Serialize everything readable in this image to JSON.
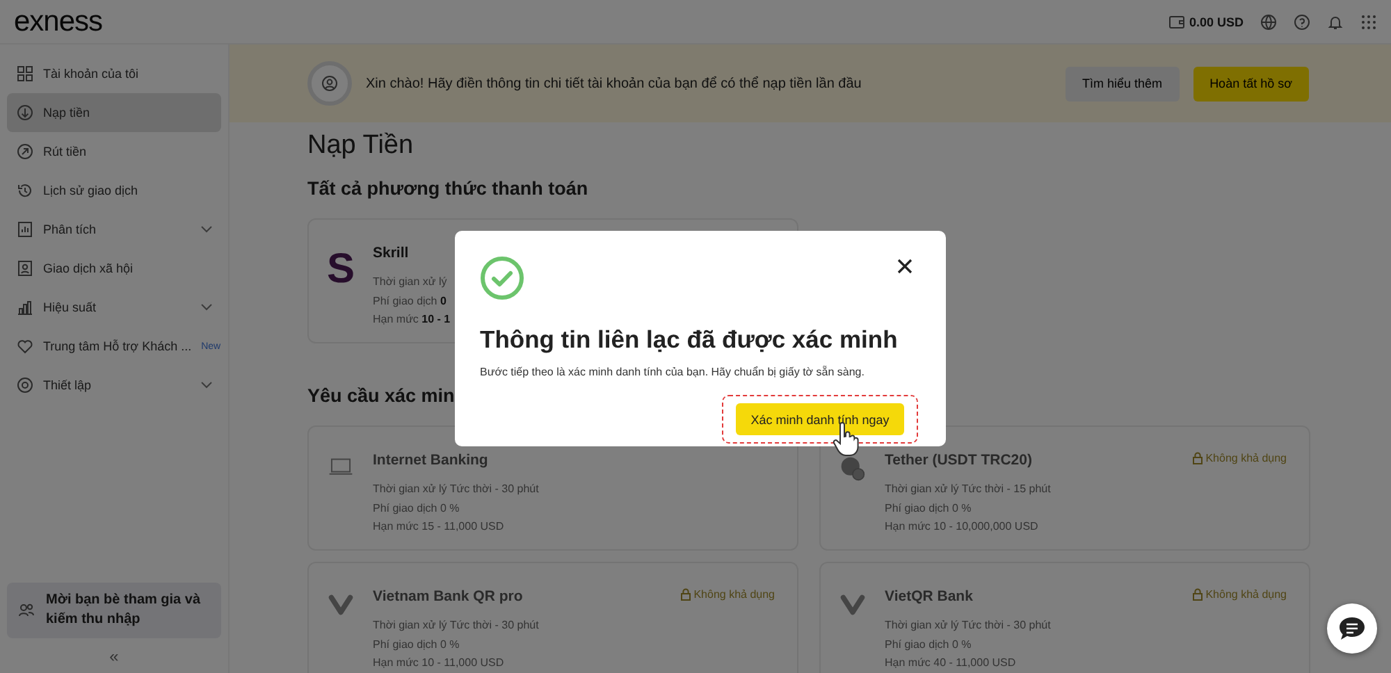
{
  "header": {
    "logo": "exness",
    "balance": "0.00 USD"
  },
  "sidebar": {
    "items": [
      {
        "label": "Tài khoản của tôi",
        "selected": false,
        "expandable": false
      },
      {
        "label": "Nạp tiền",
        "selected": true,
        "expandable": false
      },
      {
        "label": "Rút tiền",
        "selected": false,
        "expandable": false
      },
      {
        "label": "Lịch sử giao dịch",
        "selected": false,
        "expandable": false
      },
      {
        "label": "Phân tích",
        "selected": false,
        "expandable": true
      },
      {
        "label": "Giao dịch xã hội",
        "selected": false,
        "expandable": false
      },
      {
        "label": "Hiệu suất",
        "selected": false,
        "expandable": true
      },
      {
        "label": "Trung tâm Hỗ trợ Khách ...",
        "selected": false,
        "expandable": false,
        "badge": "New"
      },
      {
        "label": "Thiết lập",
        "selected": false,
        "expandable": true
      }
    ],
    "invite": "Mời bạn bè tham gia và kiếm thu nhập",
    "collapse": "«"
  },
  "banner": {
    "text": "Xin chào! Hãy điền thông tin chi tiết tài khoản của bạn để có thể nạp tiền lần đầu",
    "buttons": [
      {
        "label": "Tìm hiểu thêm",
        "kind": "secondary"
      },
      {
        "label": "Hoàn tất hồ sơ",
        "kind": "primary"
      }
    ]
  },
  "page_title": "Nạp Tiền",
  "sections": [
    {
      "heading": "Tất cả phương thức thanh toán",
      "cards": [
        {
          "logo": "S",
          "name": "Skrill",
          "disabled": false,
          "lines": [
            "Thời gian xử lý",
            "Phí giao dịch **0**",
            "Hạn mức **10 - 1**"
          ]
        }
      ]
    },
    {
      "heading": "Yêu cầu xác min",
      "cards": [
        {
          "name": "Internet Banking",
          "disabled": true,
          "lines": [
            "Thời gian xử lý Tức thời - 30 phút",
            "Phí giao dịch 0 %",
            "Hạn mức 15 - 11,000 USD"
          ]
        },
        {
          "name": "Tether (USDT TRC20)",
          "disabled": true,
          "badge": "Không khả dụng",
          "lines": [
            "Thời gian xử lý Tức thời - 15 phút",
            "Phí giao dịch 0 %",
            "Hạn mức 10 - 10,000,000 USD"
          ]
        },
        {
          "name": "Vietnam Bank QR pro",
          "disabled": true,
          "badge": "Không khả dụng",
          "lines": [
            "Thời gian xử lý Tức thời - 30 phút",
            "Phí giao dịch 0 %",
            "Hạn mức 10 - 11,000 USD"
          ]
        },
        {
          "name": "VietQR Bank",
          "disabled": true,
          "badge": "Không khả dụng",
          "lines": [
            "Thời gian xử lý Tức thời - 30 phút",
            "Phí giao dịch 0 %",
            "Hạn mức 40 - 11,000 USD"
          ]
        }
      ]
    }
  ],
  "modal": {
    "title": "Thông tin liên lạc đã được xác minh",
    "text": "Bước tiếp theo là xác minh danh tính của bạn. Hãy chuẩn bị giấy tờ sẵn sàng.",
    "button": "Xác minh danh tính ngay",
    "highlighted": true
  }
}
